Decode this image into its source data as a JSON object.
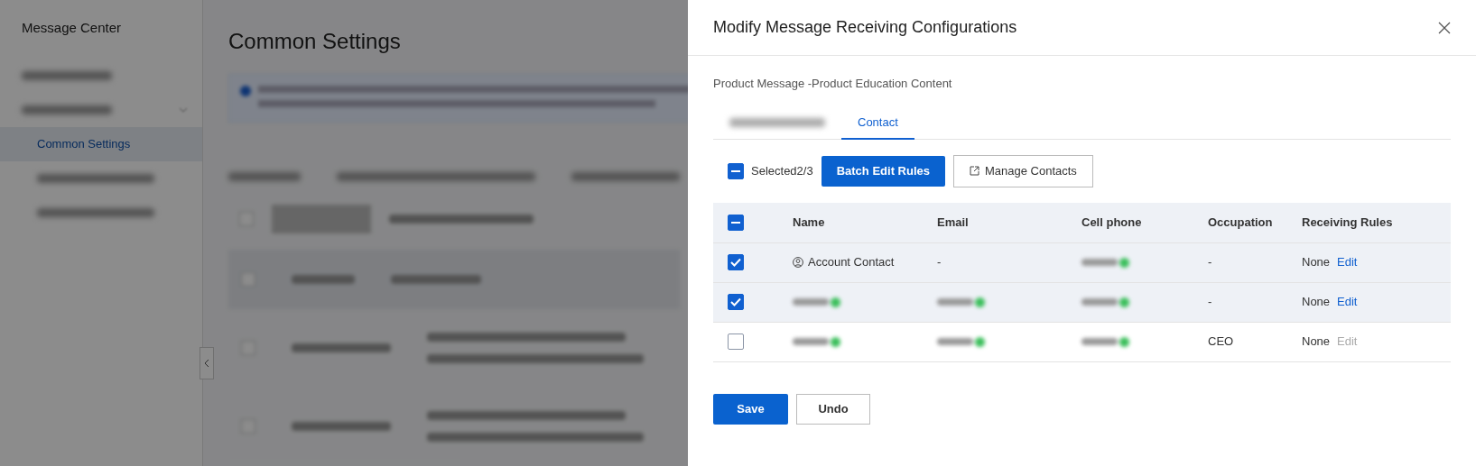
{
  "background": {
    "sidebar": {
      "title": "Message Center",
      "items": [
        {
          "kind": "blurred",
          "selected": false
        },
        {
          "kind": "blurred",
          "selected": false,
          "expanded": true,
          "children": [
            {
              "kind": "text",
              "label": "Common Settings",
              "selected": true
            },
            {
              "kind": "blurred",
              "selected": false
            },
            {
              "kind": "blurred",
              "selected": false
            }
          ]
        }
      ]
    },
    "page_title": "Common Settings"
  },
  "drawer": {
    "title": "Modify Message Receiving Configurations",
    "subtitle": "Product Message -Product Education Content",
    "tabs": [
      {
        "kind": "blurred",
        "selected": false
      },
      {
        "kind": "text",
        "label": "Contact",
        "selected": true
      }
    ],
    "toolbar": {
      "select_all": {
        "indeterminate": true
      },
      "selected_text": "Selected2/3",
      "batch_button": "Batch Edit Rules",
      "manage_button": "Manage Contacts"
    },
    "table": {
      "header_check": {
        "indeterminate": true
      },
      "columns": [
        "Name",
        "Email",
        "Cell phone",
        "Occupation",
        "Receiving Rules"
      ],
      "rows": [
        {
          "checked": true,
          "name": {
            "kind": "account",
            "text": "Account Contact"
          },
          "email": {
            "kind": "text",
            "text": "-"
          },
          "phone": {
            "kind": "blurred"
          },
          "occupation": "-",
          "rule": "None",
          "edit": {
            "label": "Edit",
            "disabled": false
          }
        },
        {
          "checked": true,
          "name": {
            "kind": "blurred"
          },
          "email": {
            "kind": "blurred"
          },
          "phone": {
            "kind": "blurred"
          },
          "occupation": "-",
          "rule": "None",
          "edit": {
            "label": "Edit",
            "disabled": false
          }
        },
        {
          "checked": false,
          "name": {
            "kind": "blurred"
          },
          "email": {
            "kind": "blurred"
          },
          "phone": {
            "kind": "blurred"
          },
          "occupation": "CEO",
          "rule": "None",
          "edit": {
            "label": "Edit",
            "disabled": true
          }
        }
      ]
    },
    "buttons": {
      "save": "Save",
      "undo": "Undo"
    }
  }
}
